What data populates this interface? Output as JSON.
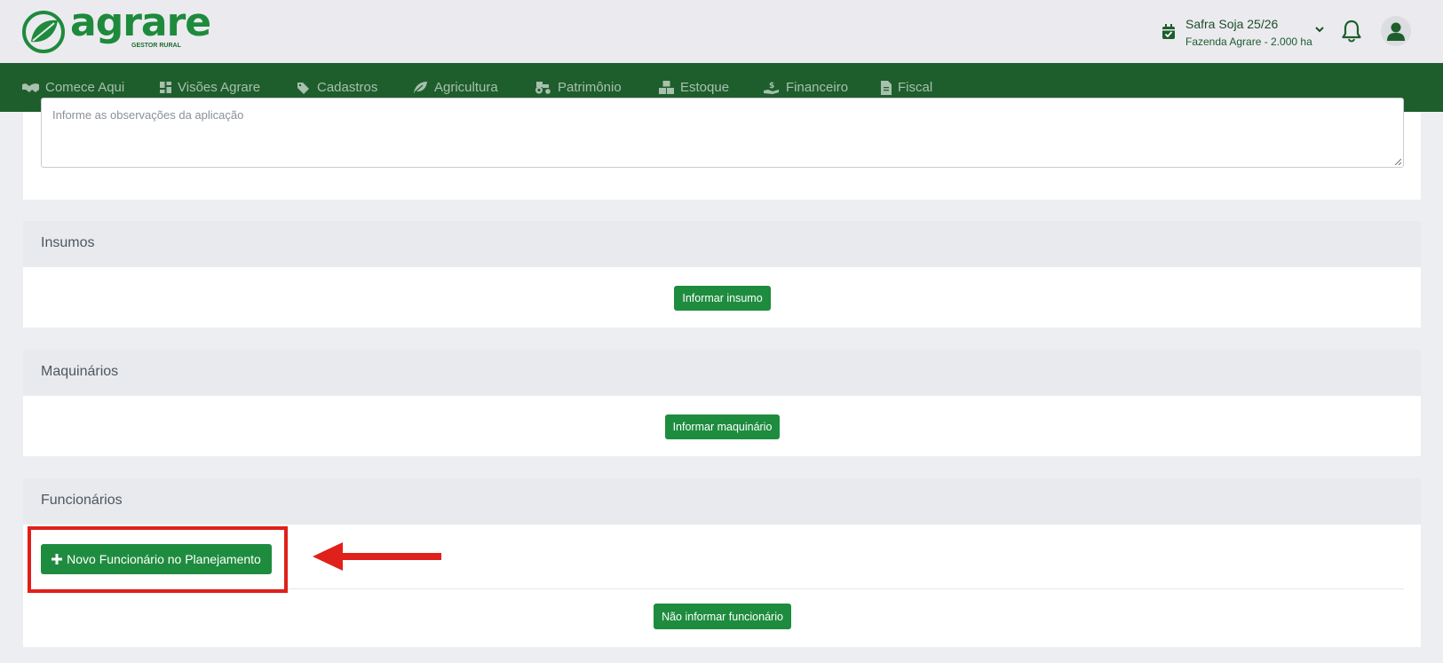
{
  "brand": {
    "name": "agrare",
    "tagline": "GESTOR RURAL",
    "accent": "#1e8a3c",
    "nav_bg": "#1e5e2c"
  },
  "header": {
    "season_title": "Safra Soja 25/26",
    "season_farm": "Fazenda Agrare - 2.000 ha",
    "icons": [
      "calendar-check-icon",
      "chevron-down-icon",
      "bell-icon",
      "user-icon"
    ]
  },
  "nav": {
    "items": [
      {
        "label": "Comece Aqui",
        "icon": "handshake-icon"
      },
      {
        "label": "Visões Agrare",
        "icon": "dashboard-icon"
      },
      {
        "label": "Cadastros",
        "icon": "tags-icon"
      },
      {
        "label": "Agricultura",
        "icon": "leaf-icon"
      },
      {
        "label": "Patrimônio",
        "icon": "tractor-icon"
      },
      {
        "label": "Estoque",
        "icon": "boxes-icon"
      },
      {
        "label": "Financeiro",
        "icon": "hand-money-icon"
      },
      {
        "label": "Fiscal",
        "icon": "invoice-icon"
      }
    ]
  },
  "observations": {
    "placeholder": "Informe as observações da aplicação"
  },
  "insumos": {
    "title": "Insumos",
    "button": "Informar insumo"
  },
  "maquinarios": {
    "title": "Maquinários",
    "button": "Informar maquinário"
  },
  "funcionarios": {
    "title": "Funcionários",
    "new_button": "Novo Funcionário no Planejamento",
    "skip_button": "Não informar funcionário"
  },
  "annotation": {
    "box_color": "#e0201a",
    "arrow_color": "#e0201a"
  }
}
